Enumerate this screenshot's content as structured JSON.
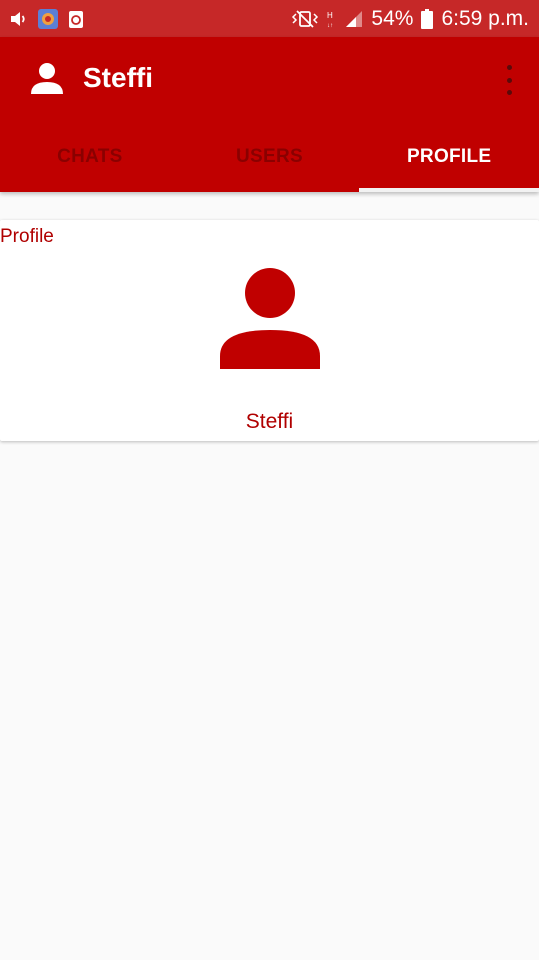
{
  "status_bar": {
    "battery": "54%",
    "time": "6:59 p.m.",
    "icons": [
      "volume-icon",
      "app-notification-icon",
      "recycle-notification-icon",
      "vibrate-icon",
      "hplus-network-icon",
      "signal-icon",
      "battery-icon"
    ]
  },
  "toolbar": {
    "title": "Steffi",
    "avatar_icon": "person-icon",
    "menu_icon": "more-vert-icon"
  },
  "tabs": [
    {
      "label": "CHATS",
      "active": false
    },
    {
      "label": "USERS",
      "active": false
    },
    {
      "label": "PROFILE",
      "active": true
    }
  ],
  "profile_card": {
    "section_label": "Profile",
    "avatar_icon": "person-icon",
    "name": "Steffi"
  },
  "colors": {
    "app_bar": "#c00000",
    "status_bar": "#c62828",
    "accent_text": "#b00000",
    "background": "#fafafa"
  }
}
